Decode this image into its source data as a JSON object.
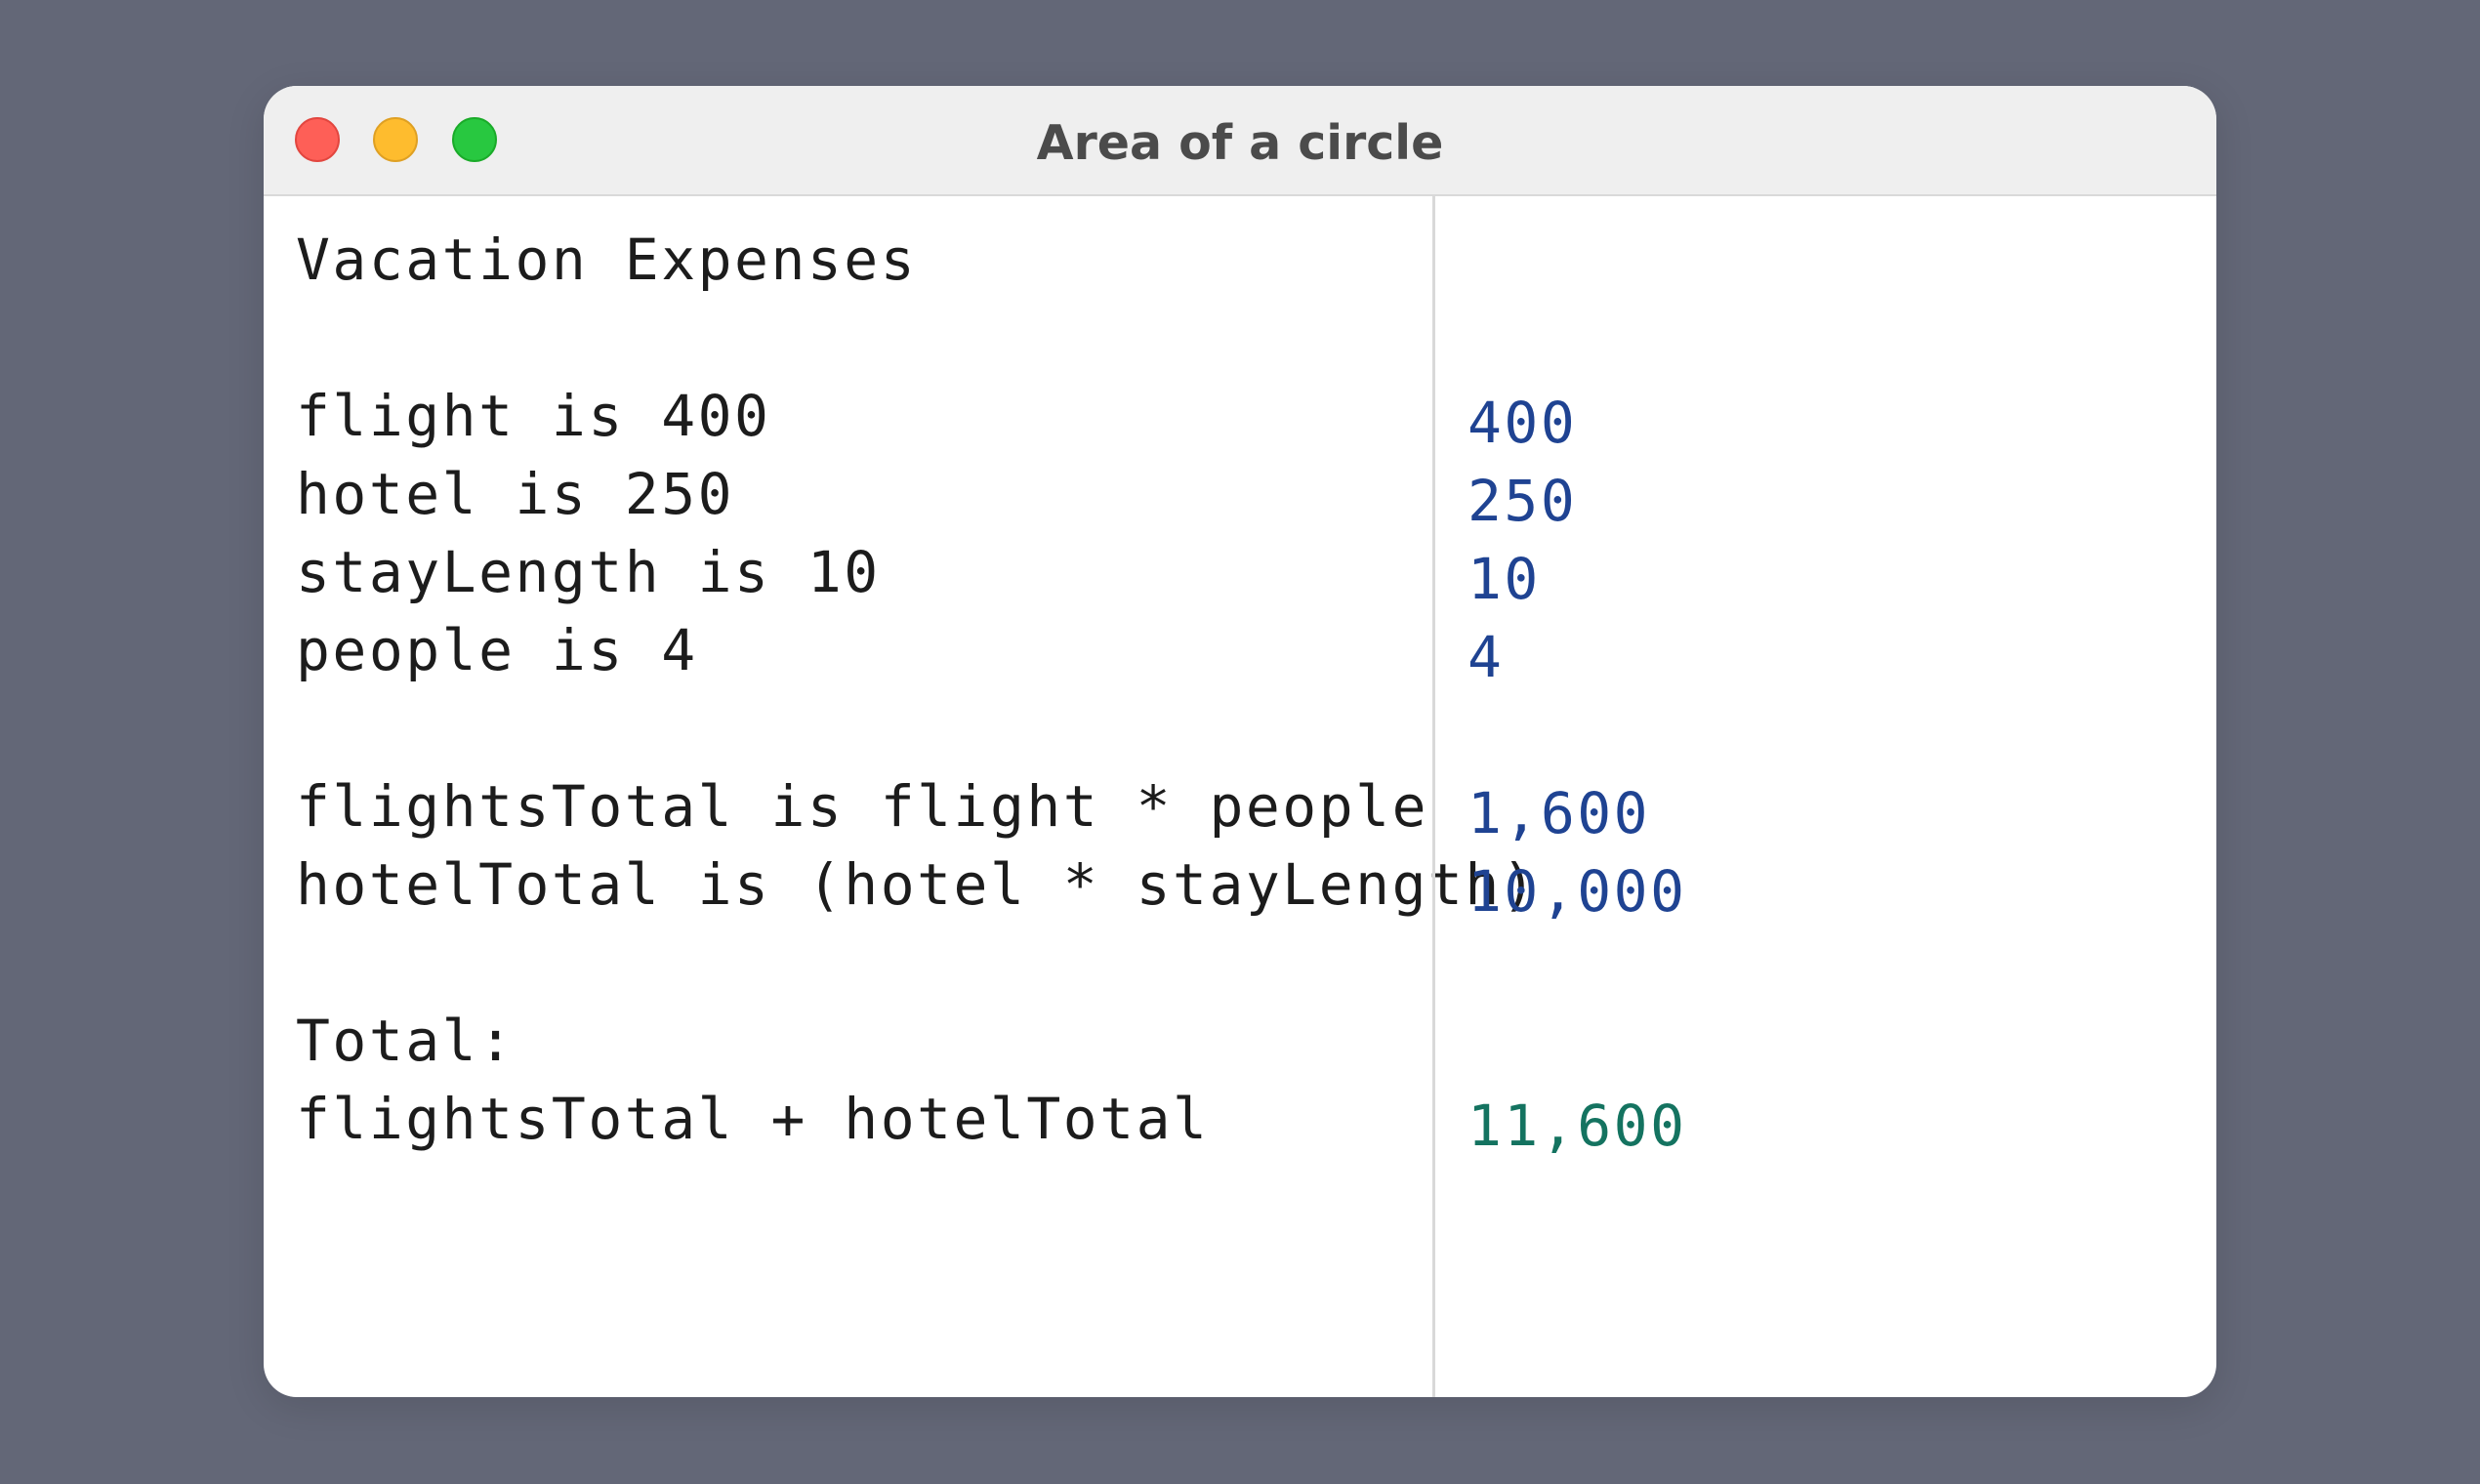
{
  "window": {
    "title": "Area of a circle"
  },
  "colors": {
    "background": "#636777",
    "result_number": "#1f4392",
    "result_total": "#147360",
    "text": "#1c1c1c"
  },
  "editor": {
    "lines": [
      "Vacation Expenses",
      "flight is 400",
      "hotel is 250",
      "stayLength is 10",
      "people is 4",
      "flightsTotal is flight * people",
      "hotelTotal is (hotel * stayLength)",
      "Total:",
      "flightsTotal + hotelTotal"
    ]
  },
  "results": {
    "flight": "400",
    "hotel": "250",
    "stayLength": "10",
    "people": "4",
    "flightsTotal": "1,600",
    "hotelTotal": "10,000",
    "total": "11,600"
  }
}
